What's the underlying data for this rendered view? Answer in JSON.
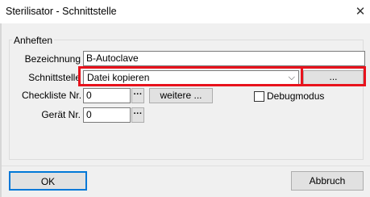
{
  "window": {
    "title": "Sterilisator - Schnittstelle",
    "close_glyph": "✕"
  },
  "group": {
    "title": "Anheften"
  },
  "fields": {
    "bezeichnung_label": "Bezeichnung",
    "bezeichnung_value": "B-Autoclave",
    "schnittstelle_label": "Schnittstelle",
    "schnittstelle_value": "Datei kopieren",
    "schnittstelle_arrow": "⌵",
    "browse_label": "...",
    "checkliste_label": "Checkliste Nr.",
    "checkliste_value": "0",
    "checkliste_lookup": "···",
    "weitere_label": "weitere ...",
    "debug_label": "Debugmodus",
    "debug_checked": false,
    "geraet_label": "Gerät Nr.",
    "geraet_value": "0",
    "geraet_lookup": "···"
  },
  "buttons": {
    "ok": "OK",
    "cancel": "Abbruch"
  },
  "colors": {
    "highlight": "#e8121c"
  }
}
